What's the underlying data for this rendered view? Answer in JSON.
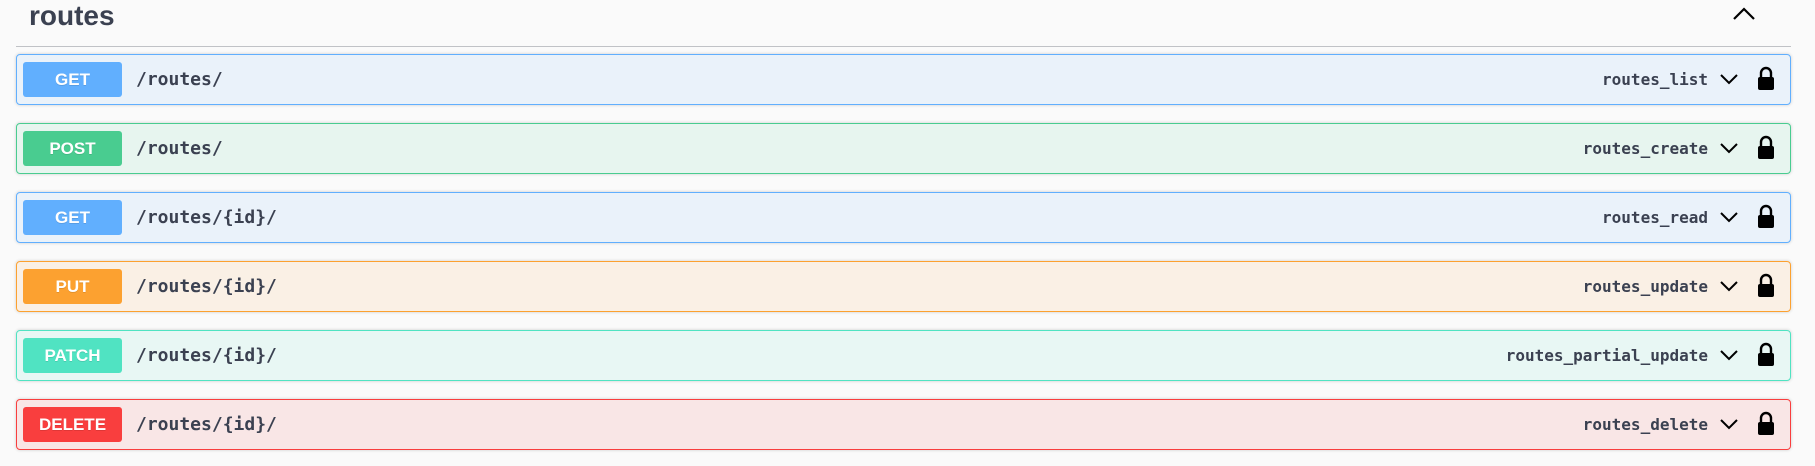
{
  "tag": {
    "title": "routes",
    "collapse_icon": "chevron-up-icon"
  },
  "operations": [
    {
      "method": "GET",
      "path": "/routes/",
      "operation_id": "routes_list",
      "expand_icon": "chevron-down-icon",
      "auth_icon": "lock-icon"
    },
    {
      "method": "POST",
      "path": "/routes/",
      "operation_id": "routes_create",
      "expand_icon": "chevron-down-icon",
      "auth_icon": "lock-icon"
    },
    {
      "method": "GET",
      "path": "/routes/{id}/",
      "operation_id": "routes_read",
      "expand_icon": "chevron-down-icon",
      "auth_icon": "lock-icon"
    },
    {
      "method": "PUT",
      "path": "/routes/{id}/",
      "operation_id": "routes_update",
      "expand_icon": "chevron-down-icon",
      "auth_icon": "lock-icon"
    },
    {
      "method": "PATCH",
      "path": "/routes/{id}/",
      "operation_id": "routes_partial_update",
      "expand_icon": "chevron-down-icon",
      "auth_icon": "lock-icon"
    },
    {
      "method": "DELETE",
      "path": "/routes/{id}/",
      "operation_id": "routes_delete",
      "expand_icon": "chevron-down-icon",
      "auth_icon": "lock-icon"
    }
  ],
  "colors": {
    "get": "#61affe",
    "post": "#49cc90",
    "put": "#fca130",
    "patch": "#50e3c2",
    "delete": "#f93e3e",
    "text": "#3b4151"
  }
}
